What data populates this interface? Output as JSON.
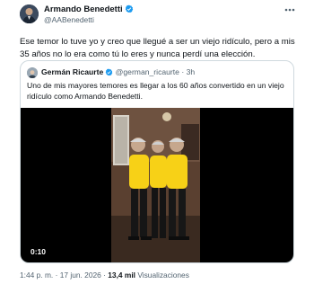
{
  "author": {
    "name": "Armando Benedetti",
    "handle": "@AABenedetti"
  },
  "tweet": {
    "text": "Ese temor lo tuve yo y creo que llegué a ser un viejo ridículo, pero a mis 35 años no lo era como tú lo eres y nunca perdí una elección."
  },
  "quote": {
    "name": "Germán Ricaurte",
    "handle": "@german_ricaurte",
    "separator": "·",
    "time": "3h",
    "text": "Uno de mis mayores temores es llegar a los 60 años convertido en un viejo ridículo como Armando Benedetti.",
    "video_duration": "0:10"
  },
  "meta": {
    "time": "1:44 p. m.",
    "dot1": "·",
    "date": "17 jun. 2026",
    "dot2": "·",
    "views_count": "13,4 mil",
    "views_label": "Visualizaciones"
  },
  "colors": {
    "verified": "#1d9bf0",
    "jersey": "#f7d117",
    "text": "#0f1419",
    "secondary": "#536471"
  }
}
